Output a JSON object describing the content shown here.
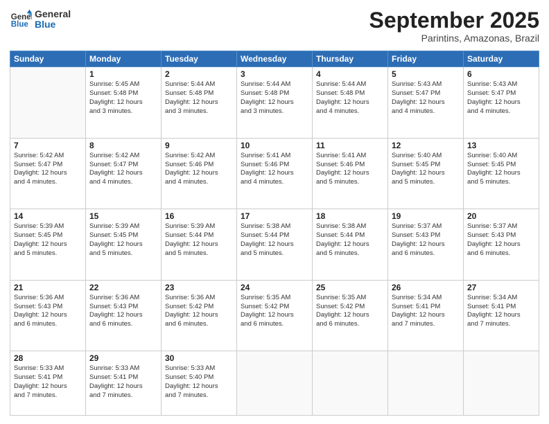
{
  "logo": {
    "general": "General",
    "blue": "Blue"
  },
  "title": "September 2025",
  "location": "Parintins, Amazonas, Brazil",
  "headers": [
    "Sunday",
    "Monday",
    "Tuesday",
    "Wednesday",
    "Thursday",
    "Friday",
    "Saturday"
  ],
  "weeks": [
    [
      {
        "day": "",
        "info": ""
      },
      {
        "day": "1",
        "info": "Sunrise: 5:45 AM\nSunset: 5:48 PM\nDaylight: 12 hours\nand 3 minutes."
      },
      {
        "day": "2",
        "info": "Sunrise: 5:44 AM\nSunset: 5:48 PM\nDaylight: 12 hours\nand 3 minutes."
      },
      {
        "day": "3",
        "info": "Sunrise: 5:44 AM\nSunset: 5:48 PM\nDaylight: 12 hours\nand 3 minutes."
      },
      {
        "day": "4",
        "info": "Sunrise: 5:44 AM\nSunset: 5:48 PM\nDaylight: 12 hours\nand 4 minutes."
      },
      {
        "day": "5",
        "info": "Sunrise: 5:43 AM\nSunset: 5:47 PM\nDaylight: 12 hours\nand 4 minutes."
      },
      {
        "day": "6",
        "info": "Sunrise: 5:43 AM\nSunset: 5:47 PM\nDaylight: 12 hours\nand 4 minutes."
      }
    ],
    [
      {
        "day": "7",
        "info": "Sunrise: 5:42 AM\nSunset: 5:47 PM\nDaylight: 12 hours\nand 4 minutes."
      },
      {
        "day": "8",
        "info": "Sunrise: 5:42 AM\nSunset: 5:47 PM\nDaylight: 12 hours\nand 4 minutes."
      },
      {
        "day": "9",
        "info": "Sunrise: 5:42 AM\nSunset: 5:46 PM\nDaylight: 12 hours\nand 4 minutes."
      },
      {
        "day": "10",
        "info": "Sunrise: 5:41 AM\nSunset: 5:46 PM\nDaylight: 12 hours\nand 4 minutes."
      },
      {
        "day": "11",
        "info": "Sunrise: 5:41 AM\nSunset: 5:46 PM\nDaylight: 12 hours\nand 5 minutes."
      },
      {
        "day": "12",
        "info": "Sunrise: 5:40 AM\nSunset: 5:45 PM\nDaylight: 12 hours\nand 5 minutes."
      },
      {
        "day": "13",
        "info": "Sunrise: 5:40 AM\nSunset: 5:45 PM\nDaylight: 12 hours\nand 5 minutes."
      }
    ],
    [
      {
        "day": "14",
        "info": "Sunrise: 5:39 AM\nSunset: 5:45 PM\nDaylight: 12 hours\nand 5 minutes."
      },
      {
        "day": "15",
        "info": "Sunrise: 5:39 AM\nSunset: 5:45 PM\nDaylight: 12 hours\nand 5 minutes."
      },
      {
        "day": "16",
        "info": "Sunrise: 5:39 AM\nSunset: 5:44 PM\nDaylight: 12 hours\nand 5 minutes."
      },
      {
        "day": "17",
        "info": "Sunrise: 5:38 AM\nSunset: 5:44 PM\nDaylight: 12 hours\nand 5 minutes."
      },
      {
        "day": "18",
        "info": "Sunrise: 5:38 AM\nSunset: 5:44 PM\nDaylight: 12 hours\nand 5 minutes."
      },
      {
        "day": "19",
        "info": "Sunrise: 5:37 AM\nSunset: 5:43 PM\nDaylight: 12 hours\nand 6 minutes."
      },
      {
        "day": "20",
        "info": "Sunrise: 5:37 AM\nSunset: 5:43 PM\nDaylight: 12 hours\nand 6 minutes."
      }
    ],
    [
      {
        "day": "21",
        "info": "Sunrise: 5:36 AM\nSunset: 5:43 PM\nDaylight: 12 hours\nand 6 minutes."
      },
      {
        "day": "22",
        "info": "Sunrise: 5:36 AM\nSunset: 5:43 PM\nDaylight: 12 hours\nand 6 minutes."
      },
      {
        "day": "23",
        "info": "Sunrise: 5:36 AM\nSunset: 5:42 PM\nDaylight: 12 hours\nand 6 minutes."
      },
      {
        "day": "24",
        "info": "Sunrise: 5:35 AM\nSunset: 5:42 PM\nDaylight: 12 hours\nand 6 minutes."
      },
      {
        "day": "25",
        "info": "Sunrise: 5:35 AM\nSunset: 5:42 PM\nDaylight: 12 hours\nand 6 minutes."
      },
      {
        "day": "26",
        "info": "Sunrise: 5:34 AM\nSunset: 5:41 PM\nDaylight: 12 hours\nand 7 minutes."
      },
      {
        "day": "27",
        "info": "Sunrise: 5:34 AM\nSunset: 5:41 PM\nDaylight: 12 hours\nand 7 minutes."
      }
    ],
    [
      {
        "day": "28",
        "info": "Sunrise: 5:33 AM\nSunset: 5:41 PM\nDaylight: 12 hours\nand 7 minutes."
      },
      {
        "day": "29",
        "info": "Sunrise: 5:33 AM\nSunset: 5:41 PM\nDaylight: 12 hours\nand 7 minutes."
      },
      {
        "day": "30",
        "info": "Sunrise: 5:33 AM\nSunset: 5:40 PM\nDaylight: 12 hours\nand 7 minutes."
      },
      {
        "day": "",
        "info": ""
      },
      {
        "day": "",
        "info": ""
      },
      {
        "day": "",
        "info": ""
      },
      {
        "day": "",
        "info": ""
      }
    ]
  ]
}
